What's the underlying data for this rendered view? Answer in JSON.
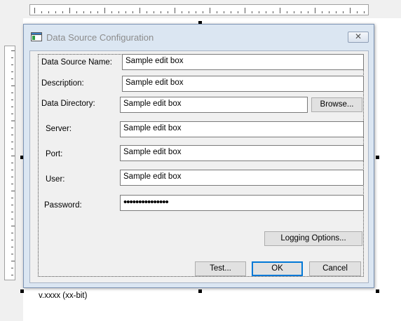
{
  "dialog": {
    "title": "Data Source Configuration",
    "close_icon": "close-icon",
    "app_icon": "window-icon"
  },
  "fields": {
    "data_source_name": {
      "label": "Data Source Name:",
      "value": "Sample edit box"
    },
    "description": {
      "label": "Description:",
      "value": "Sample edit box"
    },
    "data_directory": {
      "label": "Data Directory:",
      "value": "Sample edit box"
    },
    "server": {
      "label": "Server:",
      "value": "Sample edit box"
    },
    "port": {
      "label": "Port:",
      "value": "Sample edit box"
    },
    "user": {
      "label": "User:",
      "value": "Sample edit box"
    },
    "password": {
      "label": "Password:",
      "value": "•••••••••••••••"
    }
  },
  "buttons": {
    "browse": "Browse...",
    "logging_options": "Logging Options...",
    "test": "Test...",
    "ok": "OK",
    "cancel": "Cancel"
  },
  "version": "v.xxxx (xx-bit)",
  "colors": {
    "window_frame": "#dbe6f2",
    "client_bg": "#f0f0f0",
    "default_button_border": "#0078d7"
  }
}
